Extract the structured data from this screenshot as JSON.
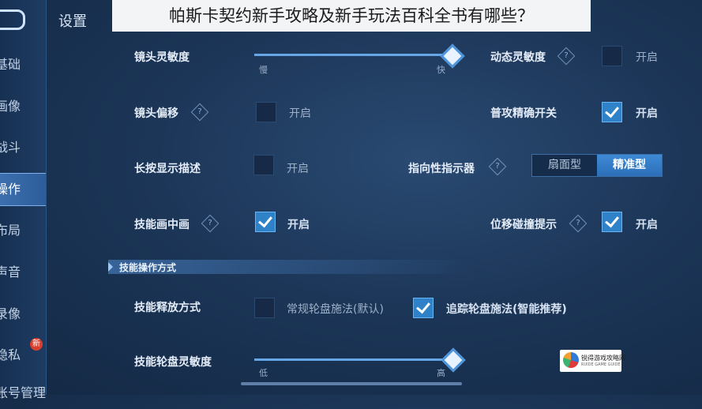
{
  "banner": "帕斯卡契约新手攻略及新手玩法百科全书有哪些？",
  "title": "设置",
  "sidebar": {
    "items": [
      {
        "label": "基础"
      },
      {
        "label": "画像"
      },
      {
        "label": "战斗"
      },
      {
        "label": "操作"
      },
      {
        "label": "布局"
      },
      {
        "label": "声音"
      },
      {
        "label": "录像"
      },
      {
        "label": "隐私"
      },
      {
        "label": "账号管理"
      }
    ],
    "new_badge": "新"
  },
  "settings": {
    "camera_sensitivity": {
      "label": "镜头灵敏度",
      "min_label": "慢",
      "max_label": "快",
      "value": 1.0
    },
    "dynamic_sensitivity": {
      "label": "动态灵敏度",
      "toggle_label": "开启",
      "checked": false
    },
    "camera_offset": {
      "label": "镜头偏移",
      "toggle_label": "开启",
      "checked": false
    },
    "precise_attack": {
      "label": "普攻精确开关",
      "toggle_label": "开启",
      "checked": true
    },
    "long_press_desc": {
      "label": "长按显示描述",
      "toggle_label": "开启",
      "checked": false
    },
    "direction_indicator": {
      "label": "指向性指示器",
      "options": [
        "扇面型",
        "精准型"
      ],
      "selected": "精准型"
    },
    "skill_pip": {
      "label": "技能画中画",
      "toggle_label": "开启",
      "checked": true
    },
    "move_collision": {
      "label": "位移碰撞提示",
      "toggle_label": "开启",
      "checked": true
    }
  },
  "section": {
    "title": "技能操作方式"
  },
  "skill_cast": {
    "label": "技能释放方式",
    "option_normal": "常规轮盘施法(默认)",
    "option_tracking": "追踪轮盘施法(智能推荐)",
    "normal_checked": false,
    "tracking_checked": true
  },
  "wheel_sensitivity": {
    "label": "技能轮盘灵敏度",
    "min_label": "低",
    "max_label": "高",
    "value": 1.0
  },
  "watermark": {
    "name": "锐得游戏攻略网",
    "sub": "RUIDE GAME GUIDE"
  }
}
